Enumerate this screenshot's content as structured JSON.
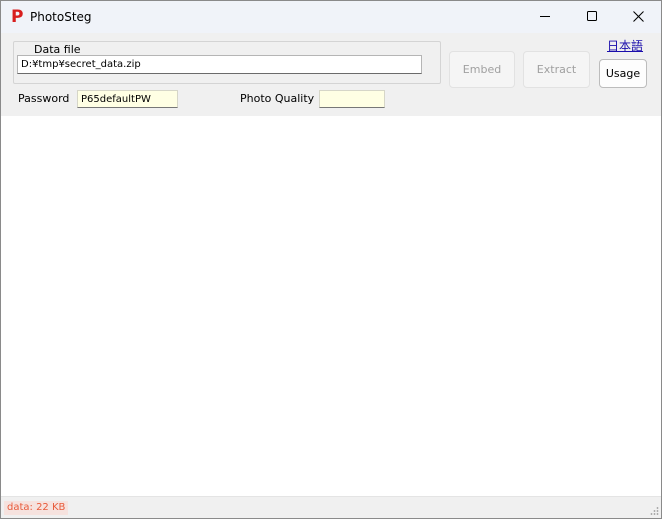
{
  "window": {
    "title": "PhotoSteg",
    "icon": "app-p-icon",
    "icon_glyph": "P",
    "icon_color": "#d81e1e"
  },
  "datafile": {
    "group_label": "Data file",
    "path": "D:¥tmp¥secret_data.zip"
  },
  "buttons": {
    "embed": "Embed",
    "extract": "Extract",
    "usage": "Usage"
  },
  "language_link": "日本語",
  "password": {
    "label": "Password",
    "value": "P65defaultPW"
  },
  "quality": {
    "label": "Photo Quality",
    "value": ""
  },
  "status": {
    "data": "data: 22 KB",
    "color": "#e85a3a"
  }
}
